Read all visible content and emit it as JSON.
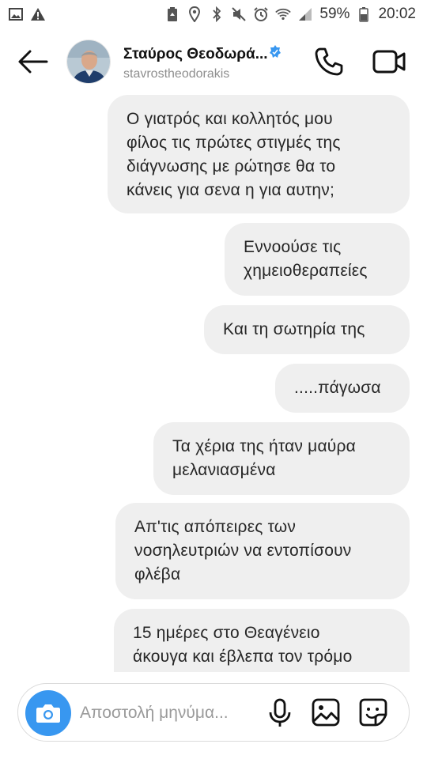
{
  "status_bar": {
    "battery": "59%",
    "time": "20:02",
    "icons": [
      "image-notification-icon",
      "warning-icon",
      "battery-saver-icon",
      "location-icon",
      "bluetooth-icon",
      "mute-icon",
      "alarm-icon",
      "wifi-icon",
      "signal-icon",
      "battery-icon"
    ]
  },
  "header": {
    "name": "Σταύρος Θεοδωρά...",
    "handle": "stavrostheodorakis",
    "icons": [
      "back-arrow-icon",
      "verified-badge-icon",
      "phone-icon",
      "video-camera-icon"
    ]
  },
  "messages": [
    {
      "lines": [
        "Ο γιατρός και κολλητός μου",
        "φίλος τις πρώτες στιγμές της",
        "διάγνωσης με ρώτησε θα το",
        "κάνεις για σενα η για αυτην;"
      ]
    },
    {
      "lines": [
        "Εννοούσε τις",
        "χημειοθεραπείες"
      ]
    },
    {
      "lines": [
        "Και τη σωτηρία της"
      ]
    },
    {
      "lines": [
        ".....πάγωσα"
      ]
    },
    {
      "lines": [
        "Τα χέρια της ήταν μαύρα",
        "μελανιασμένα"
      ]
    },
    {
      "lines": [
        "Απ'τις απόπειρες των",
        "νοσηλευτριών να εντοπίσουν",
        "φλέβα"
      ]
    },
    {
      "lines": [
        "15 ημέρες στο Θεαγένειο",
        "άκουγα και έβλεπα τον τρόμο"
      ]
    }
  ],
  "composer": {
    "placeholder": "Αποστολή μηνύμα...",
    "icons": [
      "camera-icon",
      "microphone-icon",
      "gallery-icon",
      "sticker-icon"
    ]
  },
  "colors": {
    "accent": "#3897f0",
    "bubble": "#efefef",
    "verified": "#3897f0"
  }
}
